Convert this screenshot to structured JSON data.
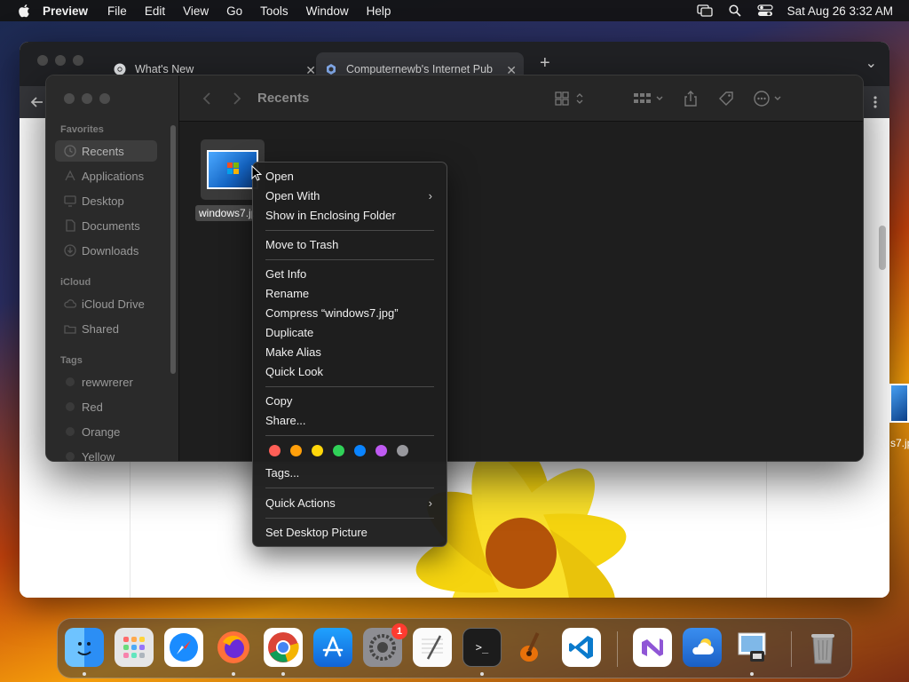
{
  "menubar": {
    "app_name": "Preview",
    "items": [
      "File",
      "Edit",
      "View",
      "Go",
      "Tools",
      "Window",
      "Help"
    ],
    "clock": "Sat Aug 26  3:32 AM"
  },
  "chrome": {
    "tabs": [
      {
        "title": "What's New"
      },
      {
        "title": "Computernewb's Internet Pub"
      }
    ],
    "new_tab": "+",
    "tab_close": "✕",
    "tab_menu": "⌄"
  },
  "finder": {
    "title": "Recents",
    "sidebar": {
      "favorites_label": "Favorites",
      "favorites": [
        "Recents",
        "Applications",
        "Desktop",
        "Documents",
        "Downloads"
      ],
      "icloud_label": "iCloud",
      "icloud": [
        "iCloud Drive",
        "Shared"
      ],
      "tags_label": "Tags",
      "tags": [
        "rewwrerer",
        "Red",
        "Orange",
        "Yellow"
      ]
    },
    "file": {
      "name": "windows7.jpg"
    }
  },
  "desktop": {
    "file_label": "s7.jp"
  },
  "context_menu": {
    "items": {
      "open": "Open",
      "open_with": "Open With",
      "show_in_folder": "Show in Enclosing Folder",
      "move_to_trash": "Move to Trash",
      "get_info": "Get Info",
      "rename": "Rename",
      "compress": "Compress “windows7.jpg”",
      "duplicate": "Duplicate",
      "make_alias": "Make Alias",
      "quick_look": "Quick Look",
      "copy": "Copy",
      "share": "Share...",
      "tags": "Tags...",
      "quick_actions": "Quick Actions",
      "set_desktop_picture": "Set Desktop Picture"
    },
    "submenu_arrow": "›",
    "tag_colors": [
      "#ff5f57",
      "#ff9f0a",
      "#ffd60a",
      "#30d158",
      "#0a84ff",
      "#bf5af2",
      "#98989d"
    ]
  },
  "dock": {
    "apps": [
      "Finder",
      "Launchpad",
      "Safari",
      "Firefox",
      "Chrome",
      "App Store",
      "System Settings",
      "TextEdit",
      "Terminal",
      "GarageBand",
      "Visual Studio Code",
      "Visual Studio",
      "Weather",
      "Preview",
      "Trash"
    ],
    "settings_badge": "1",
    "terminal_prompt": ">_"
  }
}
